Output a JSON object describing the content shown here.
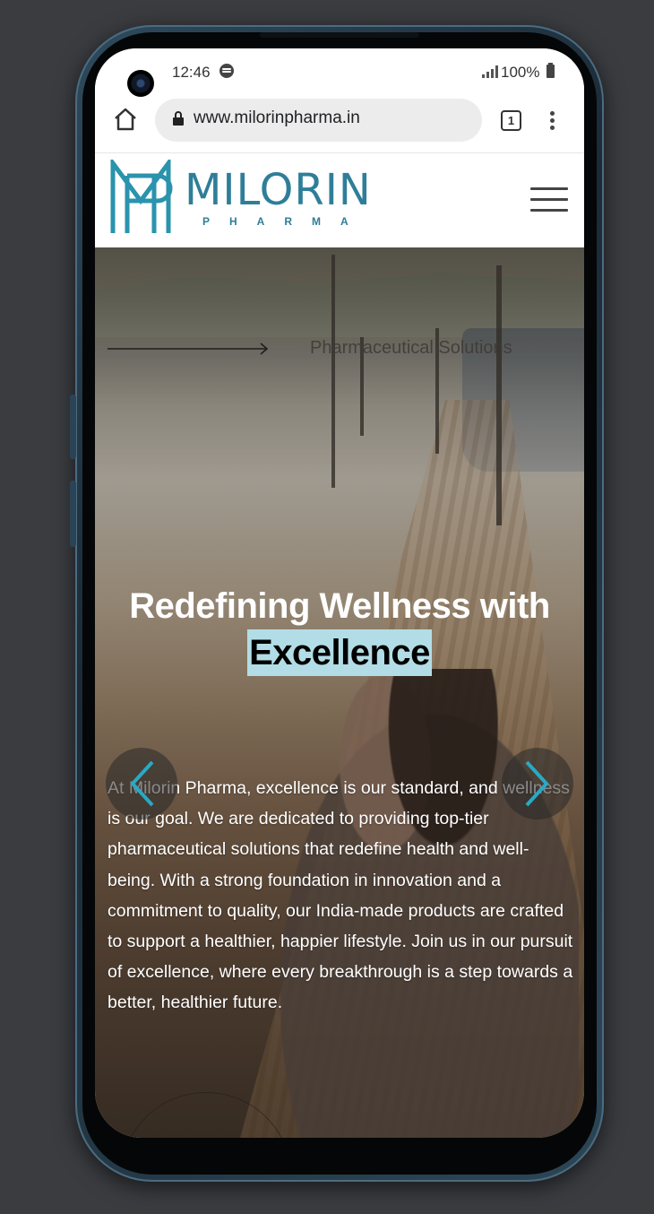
{
  "status_bar": {
    "time": "12:46",
    "battery": "100%"
  },
  "browser": {
    "url": "www.milorinpharma.in",
    "tab_count": "1"
  },
  "site": {
    "logo_name": "MILORIN",
    "logo_sub": "PHARMA",
    "brand_color": "#2f7e99"
  },
  "hero": {
    "kicker": "Pharmaceutical Solutions",
    "title_line1": "Redefining Wellness with",
    "title_highlight": "Excellence",
    "highlight_color": "#b3dde6",
    "body": "At Milorin Pharma, excellence is our standard, and wellness is our goal. We are dedicated to providing top-tier pharmaceutical solutions that redefine health and well-being. With a strong foundation in innovation and a commitment to quality, our India-made products are crafted to support a healthier, happier lifestyle. Join us in our pursuit of excellence, where every breakthrough is a step towards a better, healthier future."
  },
  "icons": {
    "home": "home-icon",
    "lock": "lock-icon",
    "tabs": "tabs-icon",
    "menu": "more-vert-icon",
    "hamburger": "hamburger-icon",
    "prev": "chevron-left-icon",
    "next": "chevron-right-icon",
    "arrow": "arrow-right-icon"
  }
}
